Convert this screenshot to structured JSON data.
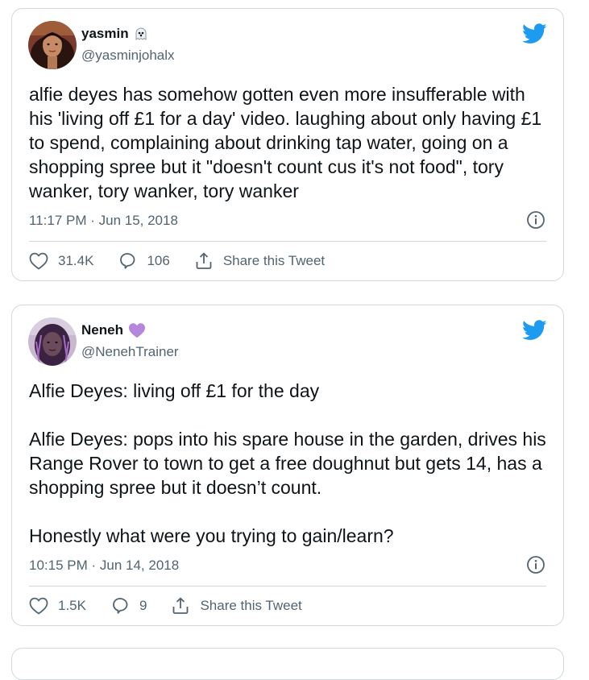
{
  "tweets": [
    {
      "display_name": "yasmin",
      "name_emoji": "ghost-icon",
      "handle": "@yasminjohalx",
      "text": "alfie deyes has somehow gotten even more insufferable with his 'living off £1 for a day' video. laughing about only having £1 to spend, complaining about drinking tap water, going on a shopping spree but it \"doesn't count cus it's not food\", tory wanker, tory wanker, tory wanker",
      "timestamp": "11:17 PM · Jun 15, 2018",
      "likes": "31.4K",
      "replies": "106",
      "share_label": "Share this Tweet"
    },
    {
      "display_name": "Neneh",
      "name_emoji": "purple-heart-icon",
      "handle": "@NenehTrainer",
      "text": "Alfie Deyes: living off £1 for the day\n\nAlfie Deyes: pops into his spare house in the garden, drives his Range Rover to town to get a free doughnut but gets 14, has a shopping spree but it doesn’t count.\n\nHonestly what were you trying to gain/learn?",
      "timestamp": "10:15 PM · Jun 14, 2018",
      "likes": "1.5K",
      "replies": "9",
      "share_label": "Share this Tweet"
    }
  ],
  "colors": {
    "twitter_blue": "#1d9bf0",
    "text_primary": "#0f1419",
    "text_secondary": "#536471",
    "border": "#cfd9de",
    "heart_purple": "#b587dc"
  },
  "icons": {
    "brand": "twitter-bird-icon",
    "info": "info-icon",
    "like": "heart-icon",
    "reply": "reply-icon",
    "share": "share-icon"
  }
}
